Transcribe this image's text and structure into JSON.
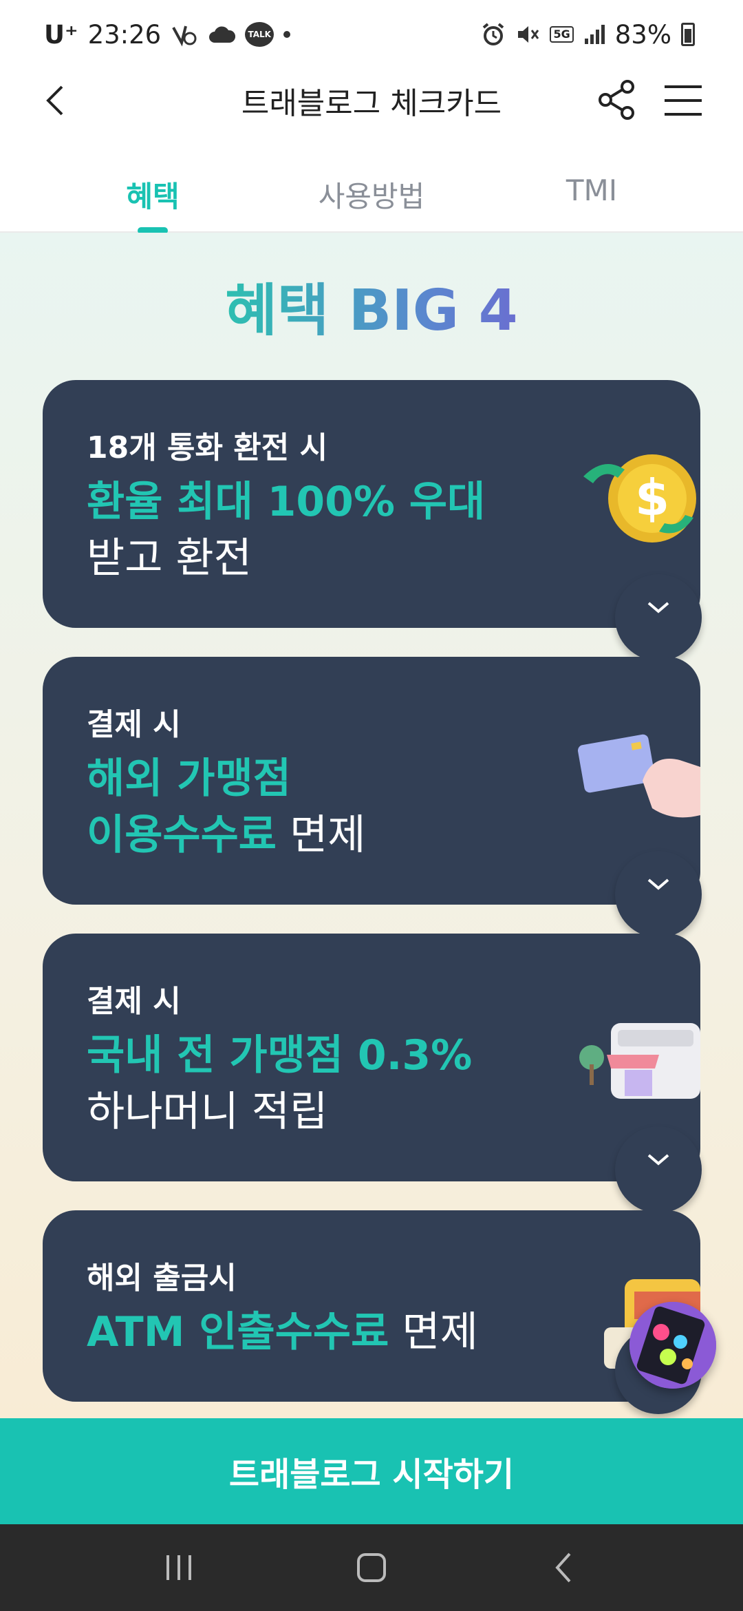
{
  "status_bar": {
    "carrier": "U⁺",
    "time": "23:26",
    "battery": "83%",
    "talk_label": "TALK",
    "network": "5G"
  },
  "header": {
    "title": "트래블로그 체크카드"
  },
  "tabs": [
    {
      "label": "혜택",
      "active": true
    },
    {
      "label": "사용방법",
      "active": false
    },
    {
      "label": "TMI",
      "active": false
    }
  ],
  "section_title": "혜택 BIG 4",
  "cards": [
    {
      "subtitle": "18개 통화 환전 시",
      "line1_highlight": "환율 최대 100% 우대",
      "line2_plain": "받고 환전",
      "icon": "dollar-coin-icon"
    },
    {
      "subtitle": "결제 시",
      "line1_highlight": "해외 가맹점",
      "line2_highlight": "이용수수료",
      "line2_plain": " 면제",
      "icon": "credit-card-hand-icon"
    },
    {
      "subtitle": "결제 시",
      "line1_highlight": "국내 전 가맹점 0.3%",
      "line2_plain": "하나머니 적립",
      "icon": "store-icon"
    },
    {
      "subtitle": "해외 출금시",
      "line1_highlight": "ATM 인출수수료",
      "line1_plain": " 면제",
      "icon": "atm-icon"
    }
  ],
  "cta_label": "트래블로그 시작하기",
  "colors": {
    "accent": "#19c2b2",
    "card_bg": "#323f55"
  }
}
